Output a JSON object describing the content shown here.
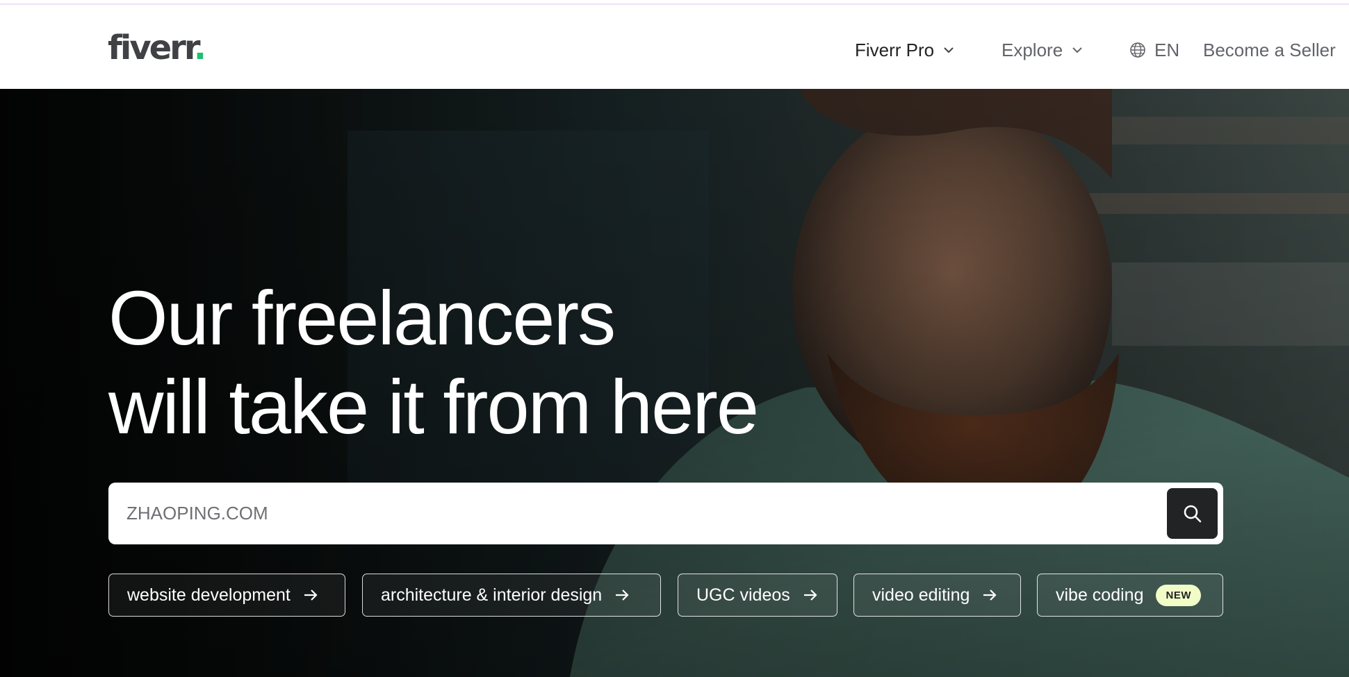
{
  "brand": {
    "logo_text": "fiverr",
    "logo_dot": ".",
    "accent_color": "#1dbf73"
  },
  "nav": {
    "fiverr_pro": "Fiverr Pro",
    "explore": "Explore",
    "language": "EN",
    "become_seller": "Become a Seller"
  },
  "hero": {
    "headline_line1": "Our freelancers",
    "headline_line2": "will take it from here",
    "search": {
      "value": "",
      "placeholder": "ZHAOPING.COM"
    },
    "chips": [
      {
        "label": "website development"
      },
      {
        "label": "architecture & interior design"
      },
      {
        "label": "UGC videos"
      },
      {
        "label": "video editing"
      },
      {
        "label": "vibe coding",
        "badge": "NEW"
      }
    ]
  },
  "icons": {
    "nav_chevron": "chevron-down-icon",
    "language": "globe-icon",
    "search": "search-icon",
    "chip_arrow": "arrow-right-icon"
  }
}
